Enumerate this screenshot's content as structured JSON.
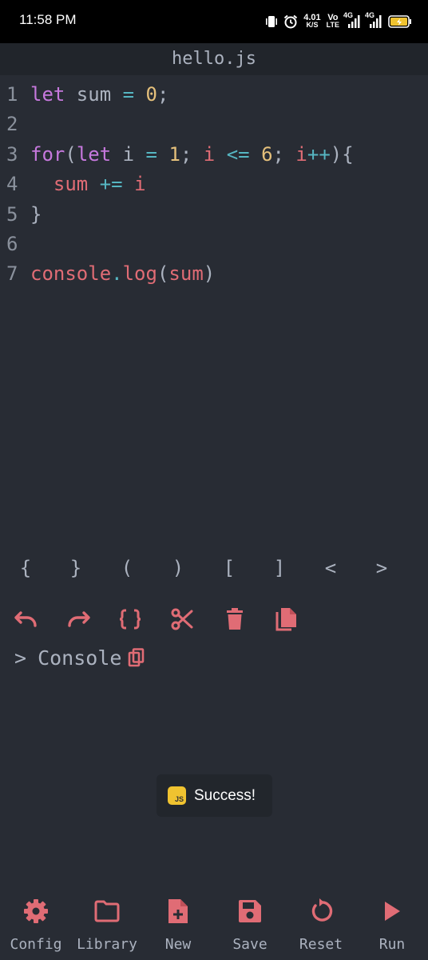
{
  "status_bar": {
    "time": "11:58 PM",
    "net_speed_value": "4.01",
    "net_speed_unit": "K/S",
    "volte_top": "Vo",
    "volte_bottom": "LTE",
    "signal1_label": "4G",
    "signal2_label": "4G",
    "icons": [
      "vibrate-icon",
      "alarm-icon",
      "signal-icon",
      "battery-charging-icon"
    ]
  },
  "editor": {
    "file_name": "hello.js",
    "line_numbers": [
      "1",
      "2",
      "3",
      "4",
      "5",
      "6",
      "7"
    ],
    "lines": [
      [
        {
          "t": "let",
          "c": "kw"
        },
        {
          "t": " sum ",
          "c": "plain"
        },
        {
          "t": "=",
          "c": "op"
        },
        {
          "t": " ",
          "c": "plain"
        },
        {
          "t": "0",
          "c": "num"
        },
        {
          "t": ";",
          "c": "plain"
        }
      ],
      [],
      [
        {
          "t": "for",
          "c": "kw"
        },
        {
          "t": "(",
          "c": "plain"
        },
        {
          "t": "let",
          "c": "kw"
        },
        {
          "t": " i ",
          "c": "plain"
        },
        {
          "t": "=",
          "c": "op"
        },
        {
          "t": " ",
          "c": "plain"
        },
        {
          "t": "1",
          "c": "num"
        },
        {
          "t": "; ",
          "c": "plain"
        },
        {
          "t": "i",
          "c": "var"
        },
        {
          "t": " ",
          "c": "plain"
        },
        {
          "t": "<=",
          "c": "op"
        },
        {
          "t": " ",
          "c": "plain"
        },
        {
          "t": "6",
          "c": "num"
        },
        {
          "t": "; ",
          "c": "plain"
        },
        {
          "t": "i",
          "c": "var"
        },
        {
          "t": "++",
          "c": "op"
        },
        {
          "t": "){",
          "c": "plain"
        }
      ],
      [
        {
          "t": "  ",
          "c": "plain"
        },
        {
          "t": "sum",
          "c": "var"
        },
        {
          "t": " ",
          "c": "plain"
        },
        {
          "t": "+=",
          "c": "op"
        },
        {
          "t": " ",
          "c": "plain"
        },
        {
          "t": "i",
          "c": "var"
        }
      ],
      [
        {
          "t": "}",
          "c": "plain"
        }
      ],
      [],
      [
        {
          "t": "console",
          "c": "var"
        },
        {
          "t": ".",
          "c": "op"
        },
        {
          "t": "log",
          "c": "var"
        },
        {
          "t": "(",
          "c": "plain"
        },
        {
          "t": "sum",
          "c": "var"
        },
        {
          "t": ")",
          "c": "plain"
        }
      ]
    ]
  },
  "bracket_keys": [
    "{",
    "}",
    "(",
    ")",
    "[",
    "]",
    "<",
    ">"
  ],
  "toolbar": {
    "icons": [
      "undo-icon",
      "redo-icon",
      "format-braces-icon",
      "cut-icon",
      "delete-icon",
      "copy-file-icon"
    ]
  },
  "console": {
    "prompt": ">",
    "label": "Console"
  },
  "toast": {
    "icon_text": "JS",
    "message": "Success!"
  },
  "bottom_nav": {
    "config": "Config",
    "library": "Library",
    "new": "New",
    "save": "Save",
    "reset": "Reset",
    "run": "Run"
  },
  "colors": {
    "background": "#282c34",
    "header": "#21252b",
    "accent": "#e06c75",
    "keyword": "#c678dd",
    "operator": "#56b6c2",
    "number": "#e5c07b",
    "text": "#abb2bf",
    "toast_icon": "#f0c330"
  }
}
